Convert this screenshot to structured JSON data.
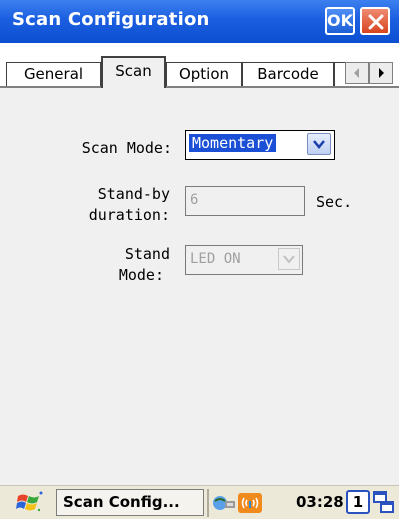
{
  "window": {
    "title": "Scan Configuration",
    "ok_label": "OK"
  },
  "tabs": [
    {
      "label": "General",
      "active": false
    },
    {
      "label": "Scan",
      "active": true
    },
    {
      "label": "Option",
      "active": false
    },
    {
      "label": "Barcode",
      "active": false
    }
  ],
  "form": {
    "scan_mode_label": "Scan Mode:",
    "scan_mode_value": "Momentary",
    "standby_label_1": "Stand-by",
    "standby_label_2": "duration:",
    "standby_value": "6",
    "standby_unit": "Sec.",
    "stand_mode_label_1": "Stand",
    "stand_mode_label_2": "Mode:",
    "stand_mode_value": "LED ON"
  },
  "taskbar": {
    "task_label": "Scan Config...",
    "time": "03:28",
    "desktop_number": "1"
  },
  "icons": [
    "close-icon",
    "tab-scroll-left-icon",
    "tab-scroll-right-icon",
    "chevron-down-icon",
    "windows-start-icon",
    "network-icon",
    "wireless-icon",
    "window-switcher-icon"
  ]
}
